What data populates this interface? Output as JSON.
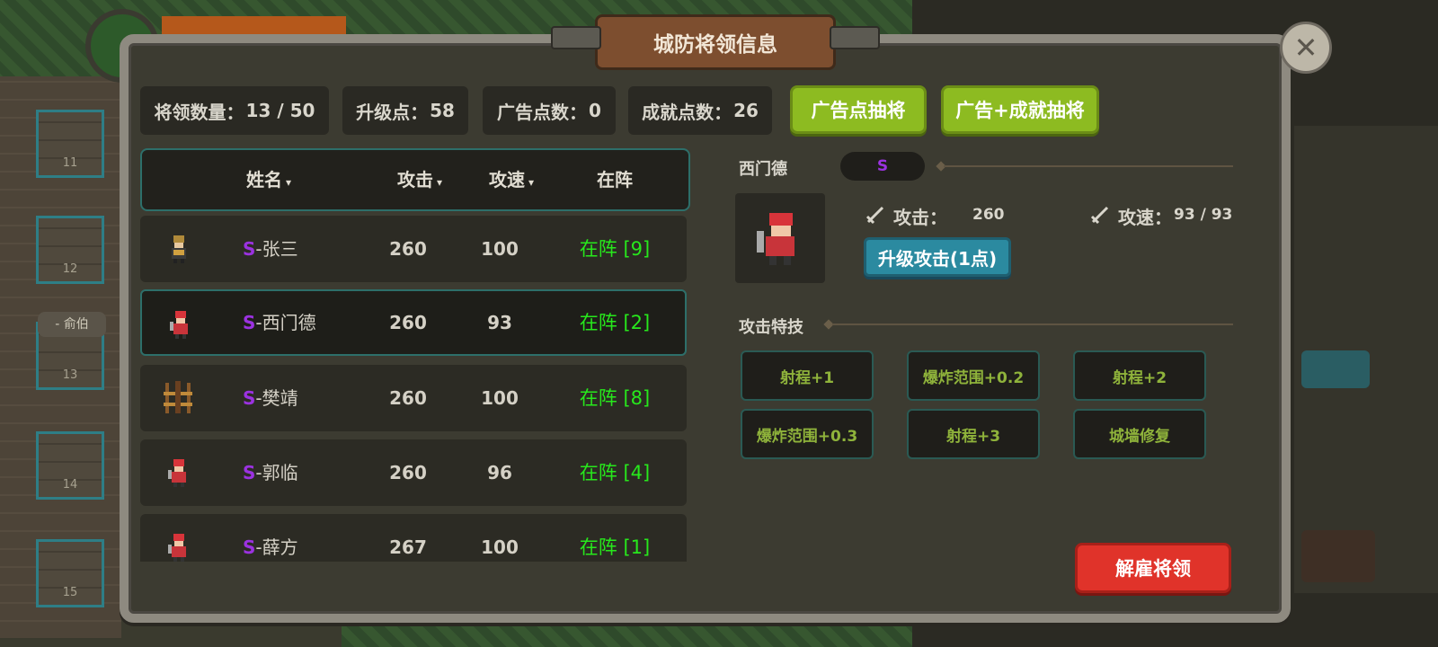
{
  "background": {
    "slots": [
      "11",
      "12",
      "13",
      "14",
      "15"
    ],
    "bubble_text": "- 俞伯"
  },
  "dialog": {
    "title": "城防将领信息",
    "close_icon": "close-icon"
  },
  "stats": {
    "general_count_label": "将领数量：",
    "general_count": "13 / 50",
    "upgrade_points_label": "升级点：",
    "upgrade_points": "58",
    "ad_points_label": "广告点数：",
    "ad_points": "0",
    "achievement_points_label": "成就点数：",
    "achievement_points": "26"
  },
  "buttons": {
    "ad_draw": "广告点抽将",
    "ad_achievement_draw": "广告+成就抽将",
    "upgrade_attack": "升级攻击(1点)",
    "dismiss": "解雇将领"
  },
  "table": {
    "headers": {
      "name": "姓名",
      "attack": "攻击",
      "speed": "攻速",
      "deployed": "在阵"
    },
    "sort_icon": "▾",
    "rows": [
      {
        "grade": "S",
        "name": "-张三",
        "attack": "260",
        "speed": "100",
        "deployed": "在阵 [9]",
        "avatar": "archer-avatar"
      },
      {
        "grade": "S",
        "name": "-西门德",
        "attack": "260",
        "speed": "93",
        "deployed": "在阵 [2]",
        "avatar": "red-warrior-avatar"
      },
      {
        "grade": "S",
        "name": "-樊靖",
        "attack": "260",
        "speed": "100",
        "deployed": "在阵 [8]",
        "avatar": "ballista-avatar"
      },
      {
        "grade": "S",
        "name": "-郭临",
        "attack": "260",
        "speed": "96",
        "deployed": "在阵 [4]",
        "avatar": "red-warrior-avatar"
      },
      {
        "grade": "S",
        "name": "-薛方",
        "attack": "267",
        "speed": "100",
        "deployed": "在阵 [1]",
        "avatar": "red-warrior-avatar"
      }
    ]
  },
  "detail": {
    "name": "西门德",
    "grade": "S",
    "attack_label": "攻击：",
    "attack_value": "260",
    "speed_label": "攻速：",
    "speed_value": "93 / 93",
    "skills_title": "攻击特技",
    "skills": [
      "射程+1",
      "爆炸范围+0.2",
      "射程+2",
      "爆炸范围+0.3",
      "射程+3",
      "城墙修复"
    ]
  },
  "colors": {
    "grade_s": "#9b32e0",
    "deployed_green": "#27e81c",
    "draw_button": "#8dbb21",
    "upgrade_button": "#2b8aa0",
    "dismiss_button": "#e0332a",
    "skill_text": "#8fb33b"
  }
}
